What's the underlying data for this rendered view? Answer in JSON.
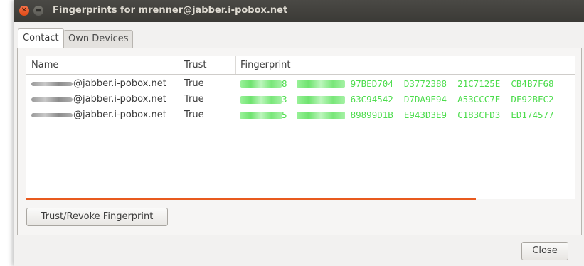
{
  "window": {
    "title": "Fingerprints for mrenner@jabber.i-pobox.net"
  },
  "tabs": [
    {
      "label": "Contact",
      "active": true
    },
    {
      "label": "Own Devices",
      "active": false
    }
  ],
  "table": {
    "columns": [
      "Name",
      "Trust",
      "Fingerprint"
    ],
    "rows": [
      {
        "name_suffix": "@jabber.i-pobox.net",
        "trust": "True",
        "fp_partial1": "8",
        "fingerprint_visible": "97BED704  D3772388  21C7125E  CB4B7F68"
      },
      {
        "name_suffix": "@jabber.i-pobox.net",
        "trust": "True",
        "fp_partial1": "3",
        "fingerprint_visible": "63C94542  D7DA9E94  A53CCC7E  DF92BFC2"
      },
      {
        "name_suffix": "@jabber.i-pobox.net",
        "trust": "True",
        "fp_partial1": "5",
        "fingerprint_visible": "89899D1B  E943D3E9  C183CFD3  ED174577"
      }
    ]
  },
  "progress": {
    "fraction": 0.82,
    "color": "#e85a1e"
  },
  "buttons": {
    "trust_revoke": "Trust/Revoke Fingerprint",
    "close": "Close"
  },
  "colors": {
    "fingerprint_text": "#4cdc4c",
    "title_bar": "#3b3a36"
  }
}
